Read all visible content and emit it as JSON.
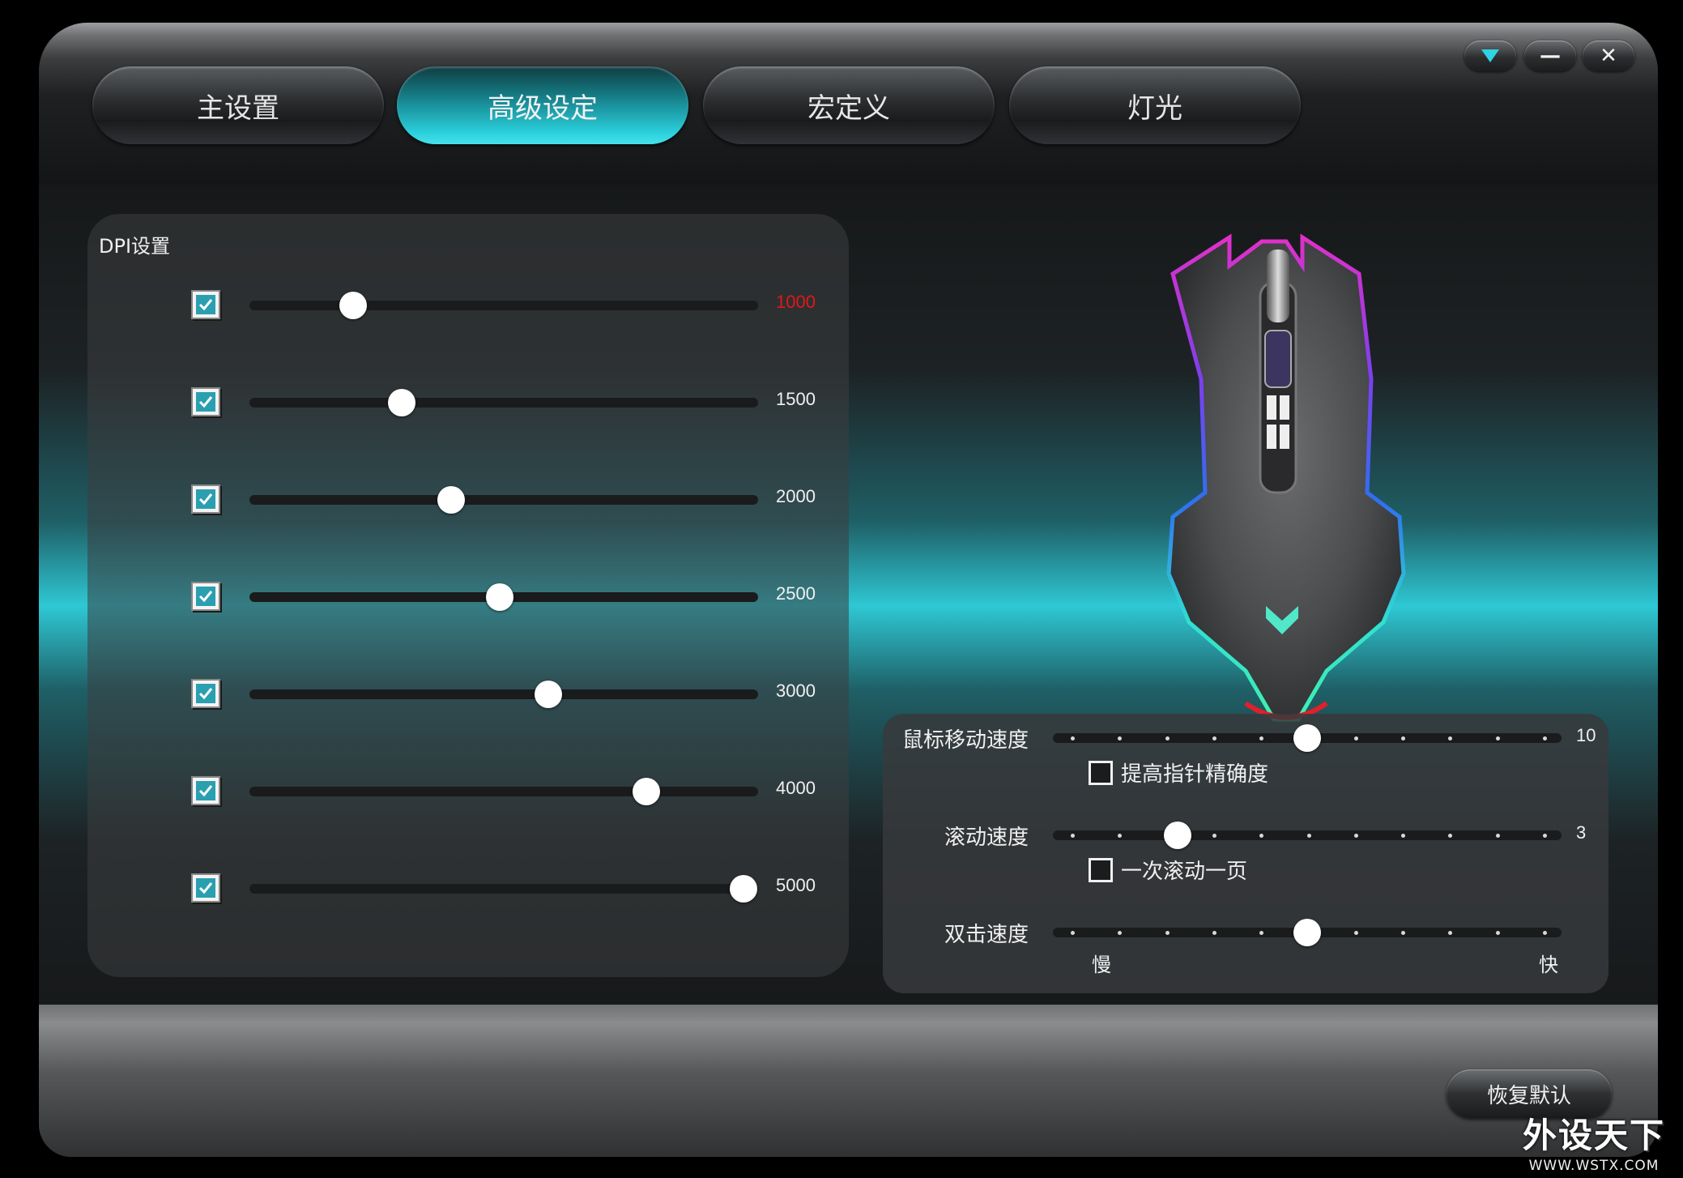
{
  "tabs": [
    {
      "label": "主设置",
      "active": false
    },
    {
      "label": "高级设定",
      "active": true
    },
    {
      "label": "宏定义",
      "active": false
    },
    {
      "label": "灯光",
      "active": false
    }
  ],
  "window_controls": {
    "dropdown_icon": "triangle-down-icon",
    "minimize_icon": "minimize-icon",
    "close_icon": "close-icon",
    "minimize_label": "—",
    "close_label": "✕"
  },
  "dpi": {
    "title": "DPI设置",
    "levels": [
      {
        "value": "1000",
        "checked": true,
        "position": 0.204,
        "selected": true
      },
      {
        "value": "1500",
        "checked": true,
        "position": 0.3,
        "selected": false
      },
      {
        "value": "2000",
        "checked": true,
        "position": 0.396,
        "selected": false
      },
      {
        "value": "2500",
        "checked": true,
        "position": 0.492,
        "selected": false
      },
      {
        "value": "3000",
        "checked": true,
        "position": 0.588,
        "selected": false
      },
      {
        "value": "4000",
        "checked": true,
        "position": 0.78,
        "selected": false
      },
      {
        "value": "5000",
        "checked": true,
        "position": 0.972,
        "selected": false
      }
    ],
    "selected_color": "#e01818"
  },
  "speed": {
    "pointer": {
      "label": "鼠标移动速度",
      "value": "10",
      "position": 0.5
    },
    "precision_option": {
      "label": "提高指针精确度",
      "checked": false
    },
    "scroll": {
      "label": "滚动速度",
      "value": "3",
      "position": 0.227
    },
    "page_scroll_option": {
      "label": "一次滚动一页",
      "checked": false
    },
    "double_click": {
      "label": "双击速度",
      "position": 0.5,
      "slow_label": "慢",
      "fast_label": "快"
    }
  },
  "restore_label": "恢复默认",
  "watermark": {
    "line1": "外设天下",
    "line2": "WWW.WSTX.COM"
  },
  "accent_color": "#2ac8d4"
}
